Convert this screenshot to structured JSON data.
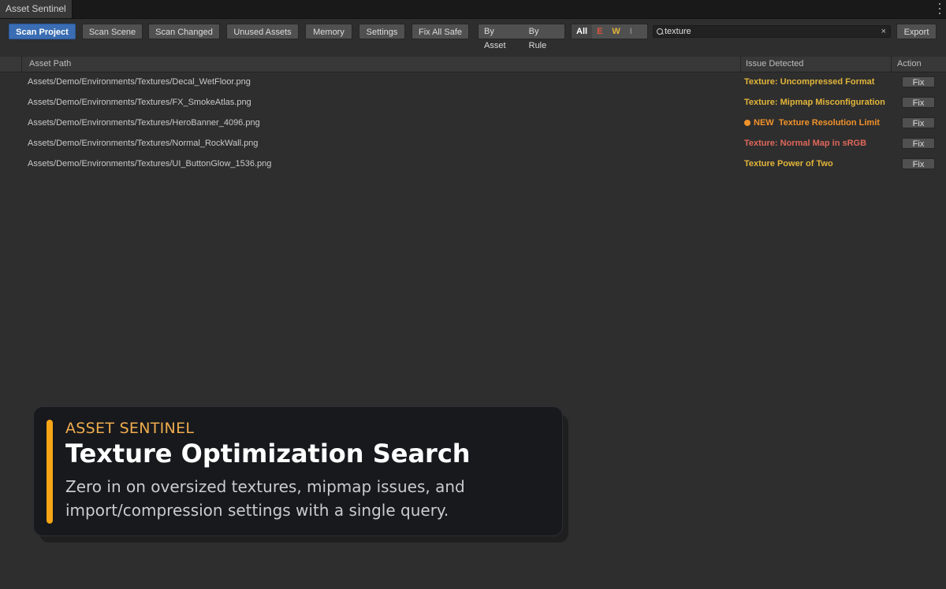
{
  "window": {
    "tab_title": "Asset Sentinel"
  },
  "toolbar": {
    "scan_project": "Scan Project",
    "scan_scene": "Scan Scene",
    "scan_changed": "Scan Changed",
    "unused_assets": "Unused Assets",
    "memory": "Memory",
    "settings": "Settings",
    "fix_all_safe": "Fix All Safe",
    "group_by": [
      "By Asset",
      "By Rule"
    ],
    "severity_filter": [
      "All",
      "E",
      "W",
      "I"
    ],
    "search_value": "texture",
    "export": "Export"
  },
  "table": {
    "columns": [
      "Asset Path",
      "Issue Detected",
      "Action"
    ],
    "rows": [
      {
        "path": "Assets/Demo/Environments/Textures/Decal_WetFloor.png",
        "issue": "Texture: Uncompressed Format",
        "color": "#e2b53a",
        "action": "Fix"
      },
      {
        "path": "Assets/Demo/Environments/Textures/FX_SmokeAtlas.png",
        "issue": "Texture: Mipmap Misconfiguration",
        "color": "#e2b53a",
        "action": "Fix"
      },
      {
        "path": "Assets/Demo/Environments/Textures/HeroBanner_4096.png",
        "issue": "NEW  Texture Resolution Limit",
        "color": "#f0922b",
        "action": "Fix"
      },
      {
        "path": "Assets/Demo/Environments/Textures/Normal_RockWall.png",
        "issue": "Texture: Normal Map in sRGB",
        "color": "#e0675a",
        "action": "Fix"
      },
      {
        "path": "Assets/Demo/Environments/Textures/UI_ButtonGlow_1536.png",
        "issue": "Texture Power of Two",
        "color": "#e2b53a",
        "action": "Fix"
      }
    ]
  },
  "overlay": {
    "kicker": "ASSET SENTINEL",
    "headline": "Texture Optimization Search",
    "description": "Zero in on oversized textures, mipmap issues, and import/compression settings with a single query."
  },
  "colors": {
    "accent": "#f5a516",
    "primary_button": "#3a6db3"
  }
}
